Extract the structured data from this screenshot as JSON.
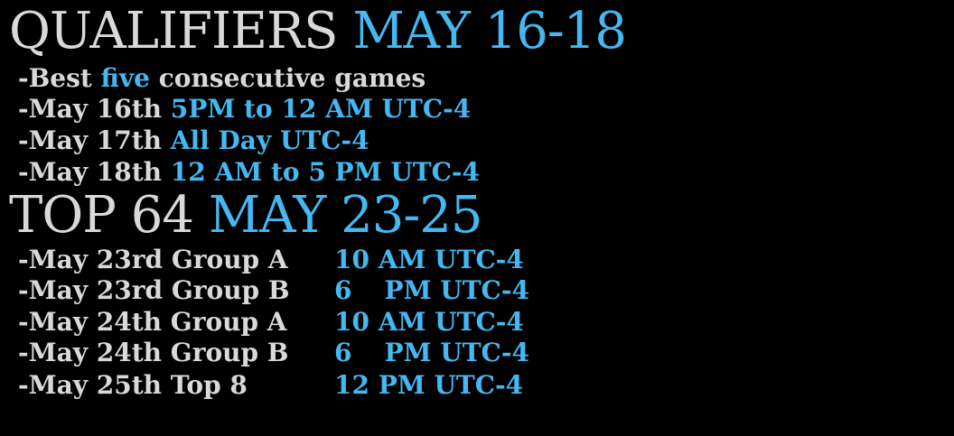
{
  "qualifiers": {
    "title": "QUALIFIERS",
    "dates": "MAY 16-18",
    "lines": [
      {
        "prefix": "-Best ",
        "highlight": "five",
        "suffix": " consecutive games"
      },
      {
        "prefix": "-May 16th ",
        "highlight": "5PM to 12 AM UTC-4"
      },
      {
        "prefix": "-May 17th ",
        "highlight": "All Day UTC-4"
      },
      {
        "prefix": "-May 18th ",
        "highlight": "12 AM to 5 PM UTC-4"
      }
    ]
  },
  "top64": {
    "title": "TOP 64",
    "dates": "MAY 23-25",
    "rows": [
      {
        "label": "-May 23rd Group A",
        "hour": "10",
        "time": "AM UTC-4"
      },
      {
        "label": "-May 23rd Group B",
        "hour": "6",
        "time": "PM UTC-4"
      },
      {
        "label": "-May 24th Group A",
        "hour": "10",
        "time": "AM UTC-4"
      },
      {
        "label": "-May 24th Group B",
        "hour": "6",
        "time": "PM UTC-4"
      },
      {
        "label": "-May 25th Top 8",
        "hour": "12",
        "time": "PM UTC-4"
      }
    ]
  },
  "colors": {
    "text": "#d9d9d9",
    "accent": "#45b8f2",
    "background": "#000000"
  }
}
